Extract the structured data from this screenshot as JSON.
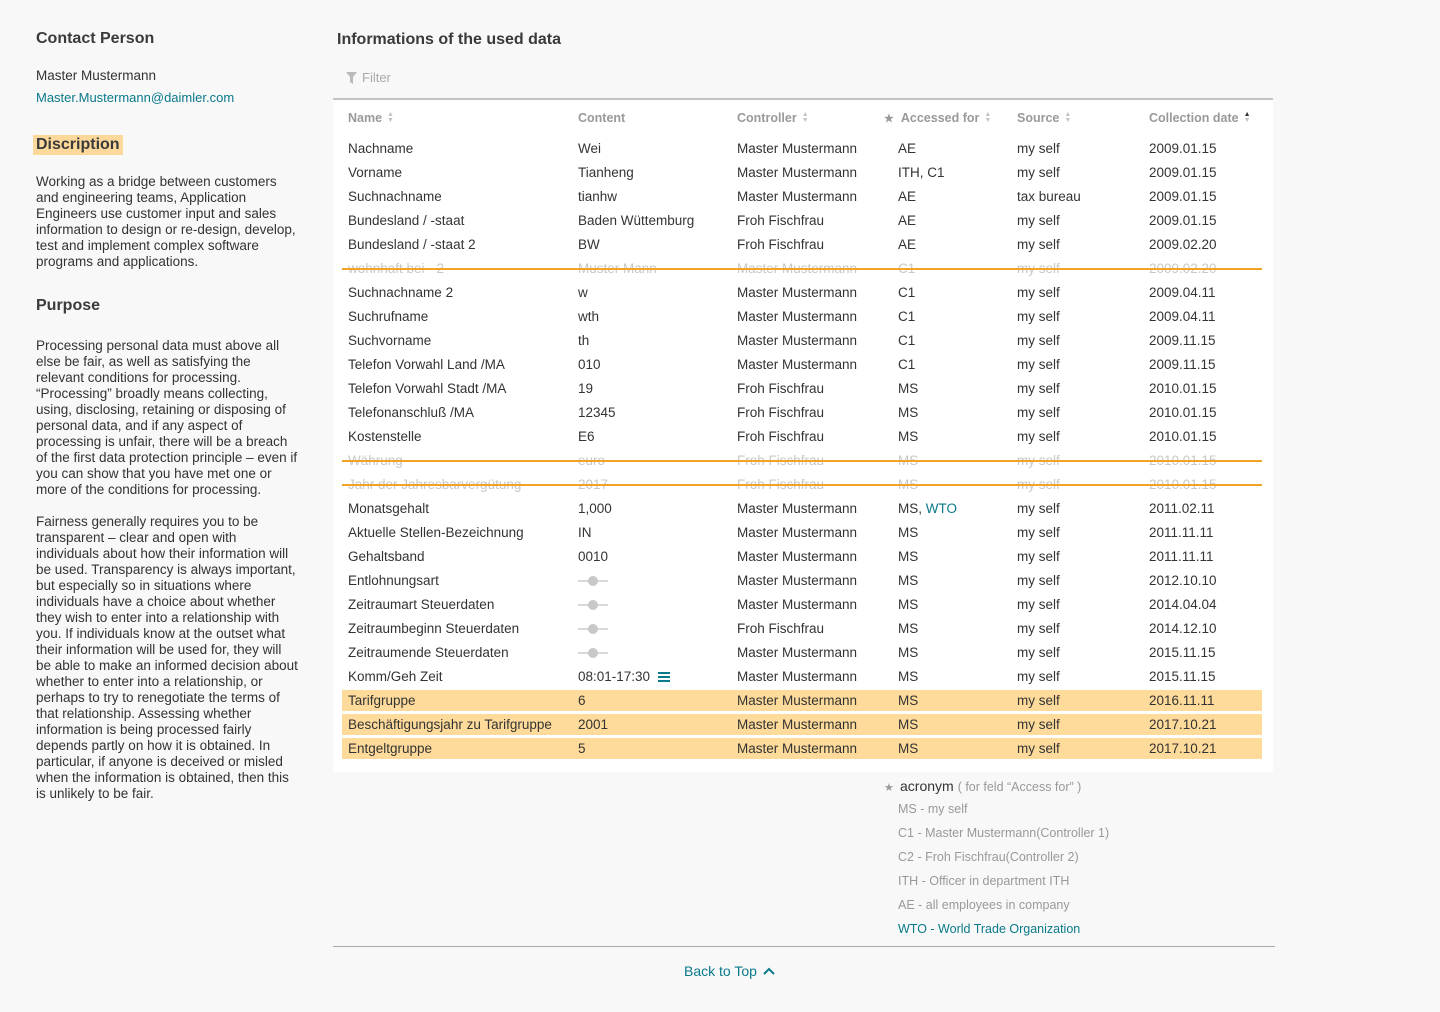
{
  "contact": {
    "heading": "Contact Person",
    "name": "Master Mustermann",
    "email": "Master.Mustermann@daimler.com"
  },
  "description": {
    "heading": "Discription",
    "text": "Working as a bridge between customers and engineering teams, Application Engineers use customer input and sales information to design or re-design, develop, test and implement complex software programs and applications."
  },
  "purpose": {
    "heading": "Purpose",
    "p1": "Processing personal data must above all else be fair, as well as satisfying the relevant conditions for processing. “Processing” broadly means collecting, using, disclosing, retaining or disposing of personal data, and if any aspect of processing is unfair, there will be a breach of the first data protection principle – even if you can show that you have met one or more of the conditions for processing.",
    "p2": "Fairness generally requires you to be transparent – clear and open with individuals about how their information will be used. Transparency is always important, but especially so in situations where individuals have a choice about whether they wish to enter into a relationship with you. If individuals know at the outset what their information will be used for, they will be able to make an informed decision about whether to enter into a relationship, or perhaps to try to renegotiate the terms of that relationship. Assessing whether information is being processed fairly depends partly on how it is obtained. In particular, if anyone is deceived or misled when the information is obtained, then this is unlikely to be fair."
  },
  "main": {
    "title": "Informations of the used data",
    "filter_placeholder": "Filter",
    "columns": {
      "name": "Name",
      "content": "Content",
      "controller": "Controller",
      "accessed_for": "Accessed for",
      "source": "Source",
      "collection_date": "Collection date"
    },
    "rows": [
      {
        "name": "Nachname",
        "content": "Wei",
        "controller": "Master Mustermann",
        "accessed": "AE",
        "source": "my self",
        "date": "2009.01.15",
        "state": "normal"
      },
      {
        "name": "Vorname",
        "content": "Tianheng",
        "controller": "Master Mustermann",
        "accessed": "ITH, C1",
        "source": "my self",
        "date": "2009.01.15",
        "state": "normal"
      },
      {
        "name": "Suchnachname",
        "content": "tianhw",
        "controller": "Master Mustermann",
        "accessed": "AE",
        "source": "tax  bureau",
        "date": "2009.01.15",
        "state": "normal"
      },
      {
        "name": "Bundesland / -staat",
        "content": "Baden Wüttemburg",
        "controller": "Froh Fischfrau",
        "accessed": "AE",
        "source": "my self",
        "date": "2009.01.15",
        "state": "normal"
      },
      {
        "name": "Bundesland / -staat 2",
        "content": "BW",
        "controller": "Froh Fischfrau",
        "accessed": "AE",
        "source": "my self",
        "date": "2009.02.20",
        "state": "normal"
      },
      {
        "name": "wohnhaft bei - 2",
        "content": "Muster Mann",
        "controller": "Master Mustermann",
        "accessed": "C1",
        "source": "my self",
        "date": "2009.02.20",
        "state": "deleted"
      },
      {
        "name": "Suchnachname 2",
        "content": "w",
        "controller": "Master Mustermann",
        "accessed": "C1",
        "source": "my self",
        "date": "2009.04.11",
        "state": "normal"
      },
      {
        "name": "Suchrufname",
        "content": "wth",
        "controller": "Master Mustermann",
        "accessed": "C1",
        "source": "my self",
        "date": "2009.04.11",
        "state": "normal"
      },
      {
        "name": "Suchvorname",
        "content": "th",
        "controller": "Master Mustermann",
        "accessed": "C1",
        "source": "my self",
        "date": "2009.11.15",
        "state": "normal"
      },
      {
        "name": "Telefon Vorwahl Land /MA",
        "content": "010",
        "controller": "Master Mustermann",
        "accessed": "C1",
        "source": "my self",
        "date": "2009.11.15",
        "state": "normal"
      },
      {
        "name": "Telefon Vorwahl Stadt /MA",
        "content": "19",
        "controller": "Froh Fischfrau",
        "accessed": "MS",
        "source": "my self",
        "date": "2010.01.15",
        "state": "normal"
      },
      {
        "name": "Telefonanschluß /MA",
        "content": "12345",
        "controller": "Froh Fischfrau",
        "accessed": "MS",
        "source": "my self",
        "date": "2010.01.15",
        "state": "normal"
      },
      {
        "name": "Kostenstelle",
        "content": "E6",
        "controller": "Froh Fischfrau",
        "accessed": "MS",
        "source": "my self",
        "date": "2010.01.15",
        "state": "normal"
      },
      {
        "name": "Währung",
        "content": "euro",
        "controller": "Froh Fischfrau",
        "accessed": "MS",
        "source": "my self",
        "date": "2010.01.15",
        "state": "deleted"
      },
      {
        "name": "Jahr der Jahresbarvergütung",
        "content": "2017",
        "controller": "Froh Fischfrau",
        "accessed": "MS",
        "source": "my self",
        "date": "2010.01.15",
        "state": "deleted"
      },
      {
        "name": "Monatsgehalt",
        "content": "1,000",
        "controller": "Master Mustermann",
        "accessed": "MS, ",
        "accessed_link": "WTO",
        "source": "my self",
        "date": "2011.02.11",
        "state": "normal"
      },
      {
        "name": "Aktuelle Stellen-Bezeichnung",
        "content": "IN",
        "controller": "Master Mustermann",
        "accessed": "MS",
        "source": "my self",
        "date": "2011.11.11",
        "state": "normal"
      },
      {
        "name": "Gehaltsband",
        "content": "0010",
        "controller": "Master Mustermann",
        "accessed": "MS",
        "source": "my self",
        "date": "2011.11.11",
        "state": "normal"
      },
      {
        "name": "Entlohnungsart",
        "content_type": "slider",
        "controller": "Master Mustermann",
        "accessed": "MS",
        "source": "my self",
        "date": "2012.10.10",
        "state": "normal"
      },
      {
        "name": "Zeitraumart Steuerdaten",
        "content_type": "slider",
        "controller": "Master Mustermann",
        "accessed": "MS",
        "source": "my self",
        "date": "2014.04.04",
        "state": "normal"
      },
      {
        "name": "Zeitraumbeginn Steuerdaten",
        "content_type": "slider",
        "controller": "Froh Fischfrau",
        "accessed": "MS",
        "source": "my self",
        "date": "2014.12.10",
        "state": "normal"
      },
      {
        "name": "Zeitraumende Steuerdaten",
        "content_type": "slider",
        "controller": "Master Mustermann",
        "accessed": "MS",
        "source": "my self",
        "date": "2015.11.15",
        "state": "normal"
      },
      {
        "name": "Komm/Geh Zeit",
        "content": "08:01-17:30",
        "content_icon": "list-icon",
        "controller": "Master Mustermann",
        "accessed": "MS",
        "source": "my self",
        "date": "2015.11.15",
        "state": "normal"
      },
      {
        "name": "Tarifgruppe",
        "content": "6",
        "controller": "Master Mustermann",
        "accessed": "MS",
        "source": "my self",
        "date": "2016.11.11",
        "state": "highlight"
      },
      {
        "name": "Beschäftigungsjahr zu Tarifgruppe",
        "content": "2001",
        "controller": "Master Mustermann",
        "accessed": "MS",
        "source": "my self",
        "date": "2017.10.21",
        "state": "highlight"
      },
      {
        "name": "Entgeltgruppe",
        "content": "5",
        "controller": "Master Mustermann",
        "accessed": "MS",
        "source": "my self",
        "date": "2017.10.21",
        "state": "highlight"
      }
    ]
  },
  "legend": {
    "title": "acronym",
    "note": "( for feld “Access for” )",
    "items": [
      {
        "text": "MS - my self",
        "link": false
      },
      {
        "text": "C1  - Master Mustermann(Controller 1)",
        "link": false
      },
      {
        "text": "C2  - Froh Fischfrau(Controller 2)",
        "link": false
      },
      {
        "text": "ITH - Officer in department ITH",
        "link": false
      },
      {
        "text": "AE  - all employees in company",
        "link": false
      },
      {
        "text": "WTO - World Trade Organization",
        "link": true
      }
    ]
  },
  "footer": {
    "back_to_top": "Back to Top"
  },
  "colors": {
    "accent": "#0a7a8a",
    "highlight": "#fedb9a",
    "strike": "#f0a424"
  }
}
